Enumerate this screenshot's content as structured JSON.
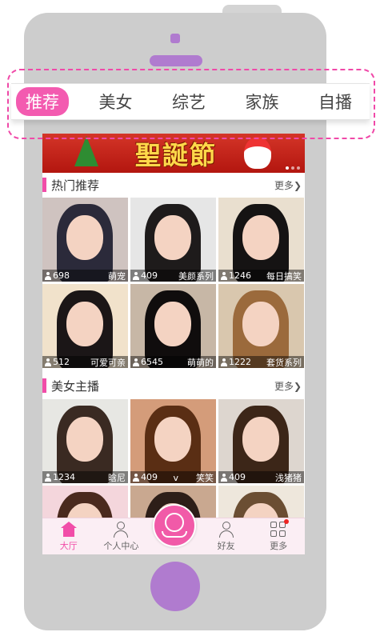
{
  "tabs": [
    {
      "label": "推荐",
      "active": true
    },
    {
      "label": "美女",
      "active": false
    },
    {
      "label": "综艺",
      "active": false
    },
    {
      "label": "家族",
      "active": false
    },
    {
      "label": "自播",
      "active": false
    }
  ],
  "banner": {
    "title": "聖誕節",
    "icon": "christmas-banner"
  },
  "hot": {
    "title": "热门推荐",
    "more": "更多❯",
    "items": [
      {
        "views": "698",
        "name": "萌宠",
        "hair": "#2b2a3a",
        "bg": "#cfc3c0"
      },
      {
        "views": "409",
        "name": "美颜系列",
        "hair": "#1e1b1b",
        "bg": "#e6e6e6"
      },
      {
        "views": "1246",
        "name": "每日搞笑",
        "hair": "#151313",
        "bg": "#e9dfcf"
      },
      {
        "views": "512",
        "name": "可爱可亲",
        "hair": "#1b1617",
        "bg": "#f1e2cb"
      },
      {
        "views": "6545",
        "name": "萌萌的",
        "hair": "#100d0d",
        "bg": "#c7b7a6"
      },
      {
        "views": "1222",
        "name": "套货系列",
        "hair": "#9b6a3c",
        "bg": "#d9c7ae"
      }
    ]
  },
  "beauty": {
    "title": "美女主播",
    "more": "更多❯",
    "items": [
      {
        "views": "1234",
        "name": "晗尼",
        "hair": "#3a2a22",
        "bg": "#e7e7e3"
      },
      {
        "views": "409",
        "name": "v　　笑笑",
        "hair": "#5a2e14",
        "bg": "#d49c7a"
      },
      {
        "views": "409",
        "name": "浅猪猪",
        "hair": "#3c2618",
        "bg": "#ddd6cf"
      },
      {
        "views": "",
        "name": "",
        "hair": "#4a2a1e",
        "bg": "#f4d6dc"
      },
      {
        "views": "",
        "name": "",
        "hair": "#2d1e18",
        "bg": "#c9a890"
      },
      {
        "views": "",
        "name": "",
        "hair": "#6b4e33",
        "bg": "#eee7dc"
      }
    ]
  },
  "nav": {
    "hall": "大厅",
    "profile": "个人中心",
    "friends": "好友",
    "more": "更多"
  },
  "colors": {
    "accent": "#f14da8",
    "frame": "#cdcdcd",
    "button": "#b07bcf"
  }
}
